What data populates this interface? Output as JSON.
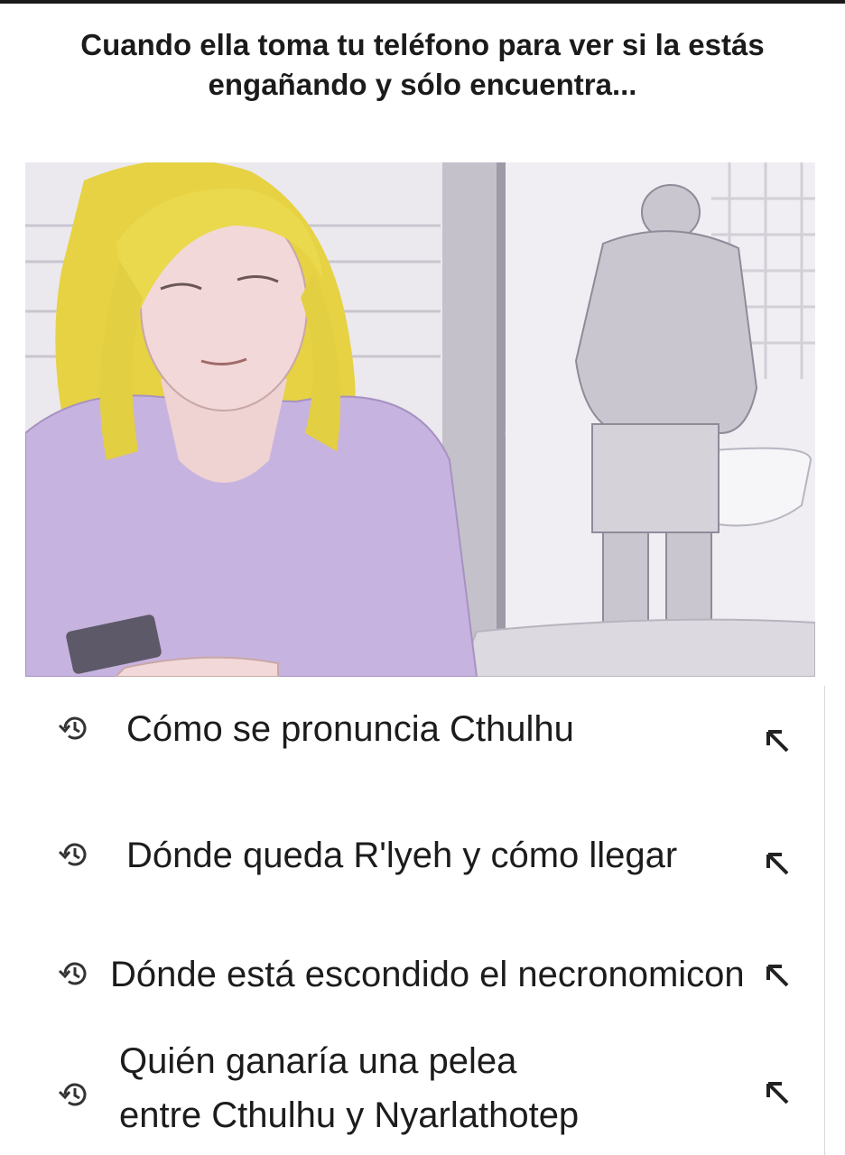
{
  "caption": "Cuando ella toma tu teléfono para ver si la estás engañando y sólo encuentra...",
  "illustration": {
    "alt": "",
    "colors": {
      "shirt": "#c9b6e0",
      "hair": "#e8d44a",
      "skin": "#f1d6d6",
      "wall": "#ece9ef",
      "door": "#bfbcc6"
    }
  },
  "search_history": {
    "icon": "history-icon",
    "fill_icon": "arrow-up-left-icon",
    "items": [
      {
        "text": "Cómo se pronuncia Cthulhu"
      },
      {
        "text": "Dónde queda R'lyeh y cómo llegar"
      },
      {
        "text": "Dónde está escondido el necronomicon"
      },
      {
        "line1": "Quién ganaría una pelea",
        "line2": "entre Cthulhu y Nyarlathotep"
      }
    ]
  }
}
